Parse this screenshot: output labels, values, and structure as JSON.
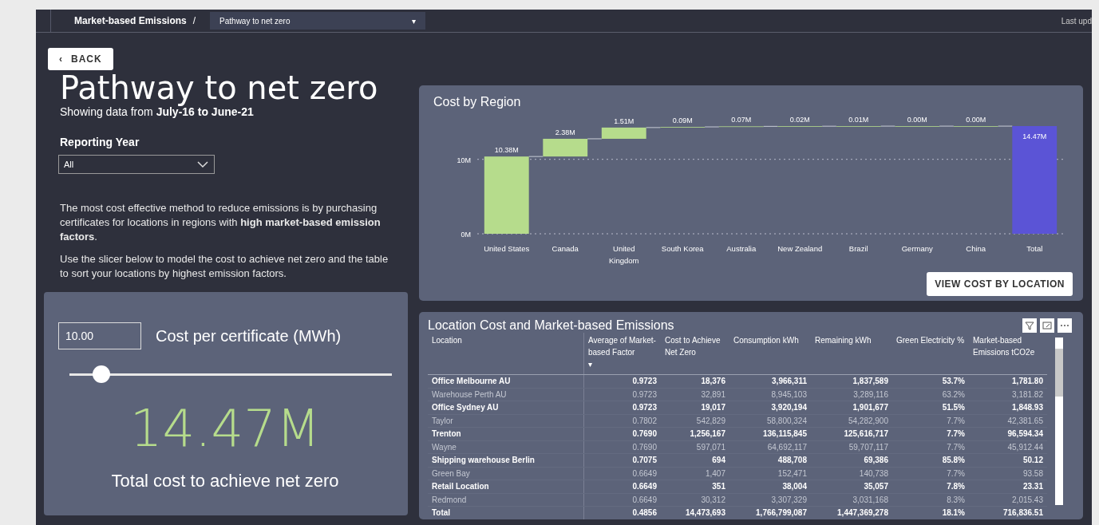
{
  "top_bar": {
    "breadcrumb": "Market-based Emissions",
    "separator": "/",
    "page_dropdown": {
      "value": "Pathway to net zero",
      "caret": "▾"
    },
    "last_updated": "Last upd"
  },
  "back_button": {
    "icon": "‹",
    "label": "BACK"
  },
  "title": "Pathway to net zero",
  "subtitle": "Showing data from **July-16 to June-21**",
  "reporting_year": {
    "label": "Reporting Year",
    "value": "All"
  },
  "description": [
    "The most cost effective method to reduce emissions is by purchasing certificates for locations in regions with **high market-based emission factors**.",
    "Use the slicer below to model the cost to achieve net zero and the table to sort your locations by highest emission factors."
  ],
  "slicer": {
    "value": "10.00",
    "label": "Cost per certificate (MWh)",
    "level": 0.1,
    "big_number": "14.47M",
    "caption": "Total cost to achieve net zero"
  },
  "cost_chart": {
    "title": "Cost by Region",
    "button": "VIEW COST BY LOCATION",
    "axis_labels": [
      "10M",
      "0M"
    ],
    "bars": [
      {
        "kind": "increase",
        "category": "United States",
        "value_label": "10.38M"
      },
      {
        "kind": "increase",
        "category": "Canada",
        "value_label": "2.38M"
      },
      {
        "kind": "increase",
        "category": "United Kingdom",
        "value_label": "1.51M"
      },
      {
        "kind": "increase",
        "category": "South Korea",
        "value_label": "0.09M"
      },
      {
        "kind": "increase",
        "category": "Australia",
        "value_label": "0.07M"
      },
      {
        "kind": "increase",
        "category": "New Zealand",
        "value_label": "0.02M"
      },
      {
        "kind": "increase",
        "category": "Brazil",
        "value_label": "0.01M"
      },
      {
        "kind": "increase",
        "category": "Germany",
        "value_label": "0.00M"
      },
      {
        "kind": "increase",
        "category": "China",
        "value_label": "0.00M"
      },
      {
        "kind": "total",
        "category": "Total",
        "value_label": "14.47M"
      }
    ]
  },
  "table": {
    "title": "Location Cost and Market-based Emissions",
    "columns": [
      "Location",
      "Average of Market-based Factor",
      "Cost to Achieve Net Zero",
      "Consumption kWh",
      "Remaining kWh",
      "Green Electricity %",
      "Market-based Emissions tCO2e"
    ],
    "sort_mark": "▾",
    "rows": [
      {
        "emphasized": true,
        "cells": [
          "Office Melbourne AU",
          "0.9723",
          "18,376",
          "3,966,311",
          "1,837,589",
          "53.7%",
          "1,781.80"
        ]
      },
      {
        "emphasized": false,
        "cells": [
          "Warehouse Perth AU",
          "0.9723",
          "32,891",
          "8,945,103",
          "3,289,116",
          "63.2%",
          "3,181.82"
        ]
      },
      {
        "emphasized": true,
        "cells": [
          "Office Sydney AU",
          "0.9723",
          "19,017",
          "3,920,194",
          "1,901,677",
          "51.5%",
          "1,848.93"
        ]
      },
      {
        "emphasized": false,
        "cells": [
          "Taylor",
          "0.7802",
          "542,829",
          "58,800,324",
          "54,282,900",
          "7.7%",
          "42,381.65"
        ]
      },
      {
        "emphasized": true,
        "cells": [
          "Trenton",
          "0.7690",
          "1,256,167",
          "136,115,845",
          "125,616,717",
          "7.7%",
          "96,594.34"
        ]
      },
      {
        "emphasized": false,
        "cells": [
          "Wayne",
          "0.7690",
          "597,071",
          "64,692,117",
          "59,707,117",
          "7.7%",
          "45,912.44"
        ]
      },
      {
        "emphasized": true,
        "cells": [
          "Shipping warehouse Berlin",
          "0.7075",
          "694",
          "488,708",
          "69,386",
          "85.8%",
          "50.12"
        ]
      },
      {
        "emphasized": false,
        "cells": [
          "Green Bay",
          "0.6649",
          "1,407",
          "152,471",
          "140,738",
          "7.7%",
          "93.58"
        ]
      },
      {
        "emphasized": true,
        "cells": [
          "Retail Location",
          "0.6649",
          "351",
          "38,004",
          "35,057",
          "7.8%",
          "23.31"
        ]
      },
      {
        "emphasized": false,
        "cells": [
          "Redmond",
          "0.6649",
          "30,312",
          "3,307,329",
          "3,031,168",
          "8.3%",
          "2,015.43"
        ]
      }
    ],
    "total": [
      "Total",
      "0.4856",
      "14,473,693",
      "1,766,799,087",
      "1,447,369,278",
      "18.1%",
      "716,836.51"
    ]
  }
}
